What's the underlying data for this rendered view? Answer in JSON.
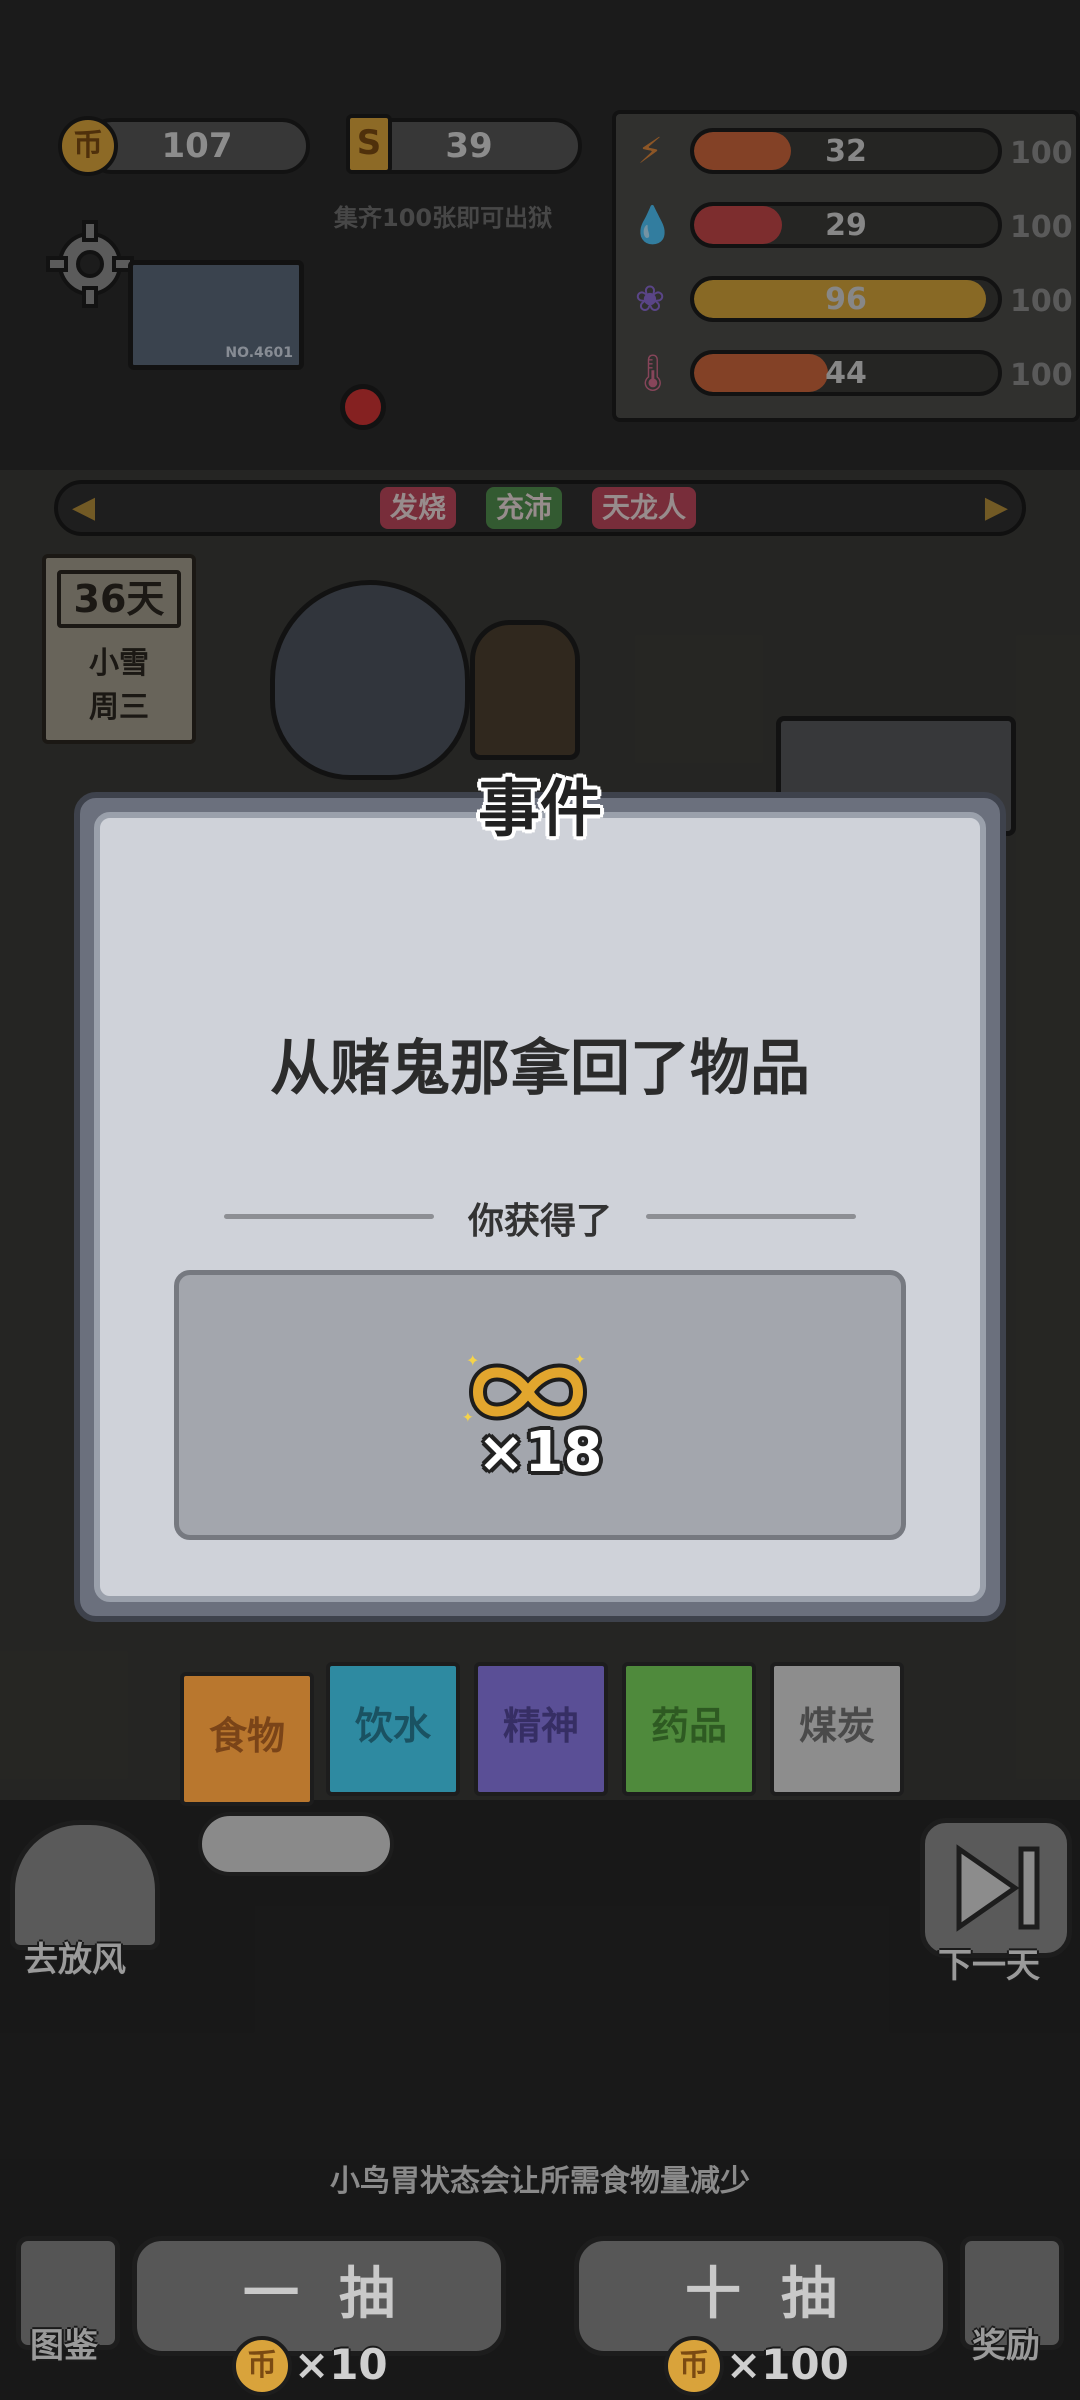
{
  "currency": {
    "coins": "107",
    "cards": "39",
    "collect_hint": "集齐100张即可出狱"
  },
  "stats": [
    {
      "icon": "lightning-icon",
      "value": "32",
      "max": "100",
      "color": "#c9643b",
      "fill": 0.32
    },
    {
      "icon": "water-drop-icon",
      "value": "29",
      "max": "100",
      "color": "#c04548",
      "fill": 0.29
    },
    {
      "icon": "brain-icon",
      "value": "96",
      "max": "100",
      "color": "#d2a23a",
      "fill": 0.96
    },
    {
      "icon": "thermometer-icon",
      "value": "44",
      "max": "100",
      "color": "#c9643b",
      "fill": 0.44
    }
  ],
  "camera": {
    "id_label": "NO.4601"
  },
  "status_tags": [
    {
      "label": "发烧",
      "color": "#b8455a"
    },
    {
      "label": "充沛",
      "color": "#4f8a4c"
    },
    {
      "label": "天龙人",
      "color": "#b8455a"
    }
  ],
  "calendar": {
    "day": "36天",
    "weather": "小雪",
    "weekday": "周三"
  },
  "event": {
    "title": "事件",
    "headline": "从赌鬼那拿回了物品",
    "gain_label": "你获得了",
    "reward": {
      "icon": "infinity-ring-icon",
      "quantity": "×18"
    }
  },
  "categories": [
    {
      "label": "食物",
      "color": "#b9772e"
    },
    {
      "label": "饮水",
      "color": "#2e8aa1"
    },
    {
      "label": "精神",
      "color": "#5a4f96"
    },
    {
      "label": "药品",
      "color": "#4f8a3c"
    },
    {
      "label": "煤炭",
      "color": "#8d8d8d"
    }
  ],
  "buttons": {
    "outing": "去放风",
    "next_day": "下一天",
    "guide": "图鉴",
    "reward": "奖励"
  },
  "tip": "小鸟胃状态会让所需食物量减少",
  "draws": {
    "single": {
      "label": "一抽",
      "cost": "×10"
    },
    "ten": {
      "label": "十抽",
      "cost": "×100"
    }
  }
}
